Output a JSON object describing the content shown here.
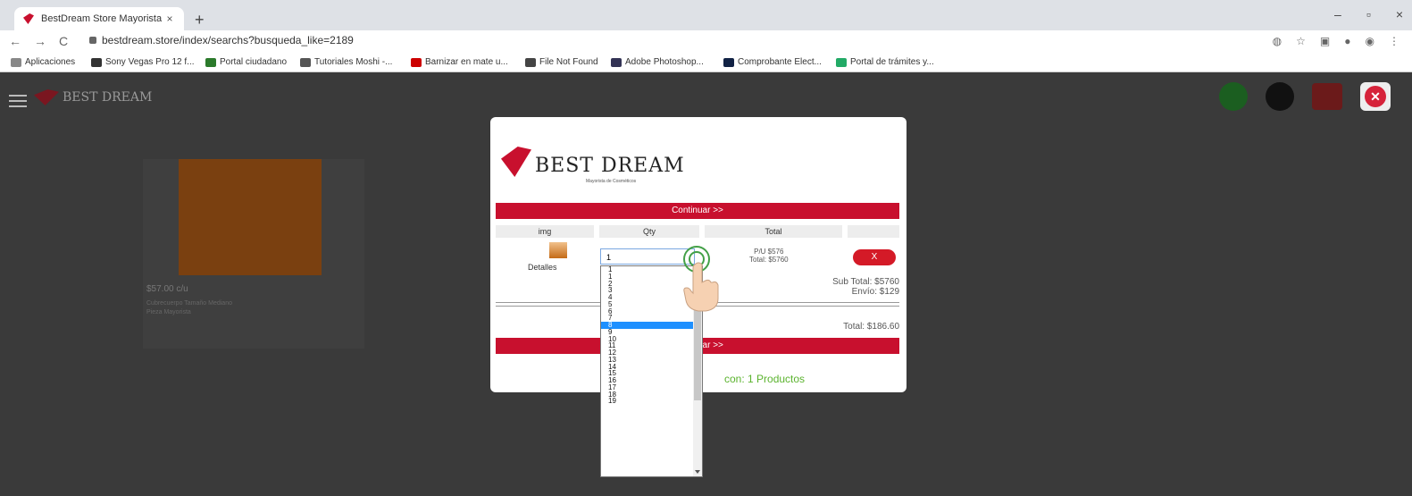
{
  "browser": {
    "tab_title": "BestDream Store Mayorista de C",
    "tab_close": "×",
    "new_tab": "+",
    "window_minimize": "–",
    "window_maximize": "▫",
    "window_close": "×",
    "url": "bestdream.store/index/searchs?busqueda_like=2189",
    "back": "←",
    "forward": "→",
    "reload": "C"
  },
  "bookmarks": [
    {
      "label": "Aplicaciones",
      "color": "#888"
    },
    {
      "label": "Sony Vegas Pro 12 f...",
      "color": "#333"
    },
    {
      "label": "Portal ciudadano",
      "color": "#2b7a2b"
    },
    {
      "label": "Tutoriales Moshi -...",
      "color": "#555"
    },
    {
      "label": "Barnizar en mate u...",
      "color": "#c00"
    },
    {
      "label": "File Not Found",
      "color": "#444"
    },
    {
      "label": "Adobe Photoshop...",
      "color": "#335"
    },
    {
      "label": "Comprobante Elect...",
      "color": "#124"
    },
    {
      "label": "Portal de trámites y...",
      "color": "#2a6"
    }
  ],
  "site": {
    "brand": "BEST DREAM"
  },
  "product_card": {
    "price": "$57.00 c/u",
    "line1": "Cubrecuerpo Tamaño Mediano",
    "line2": "Pieza Mayorista"
  },
  "modal": {
    "brand_name": "BEST DREAM",
    "brand_tagline": "Mayorista de Cosméticos",
    "continue_top": "Continuar >>",
    "continue_bottom": "Continuar >>",
    "headers": {
      "img": "img",
      "qty": "Qty",
      "total": "Total"
    },
    "item": {
      "details": "Detalles",
      "qty_value": "1",
      "unit_price": "P/U $576",
      "total": "Total: $5760",
      "remove": "X"
    },
    "subtotal": "Sub Total: $5760",
    "shipping": "Envío: $129",
    "grand_total": "Total: $186.60",
    "cart_count": "con: 1 Productos"
  },
  "dropdown": {
    "options": [
      "1",
      "1",
      "2",
      "3",
      "4",
      "5",
      "6",
      "7",
      "8",
      "9",
      "10",
      "11",
      "12",
      "13",
      "14",
      "15",
      "16",
      "17",
      "18",
      "19"
    ],
    "highlighted_index": 8
  },
  "colors": {
    "brand_red": "#c8102e",
    "highlight_blue": "#1e90ff",
    "green_text": "#5bb32e"
  }
}
